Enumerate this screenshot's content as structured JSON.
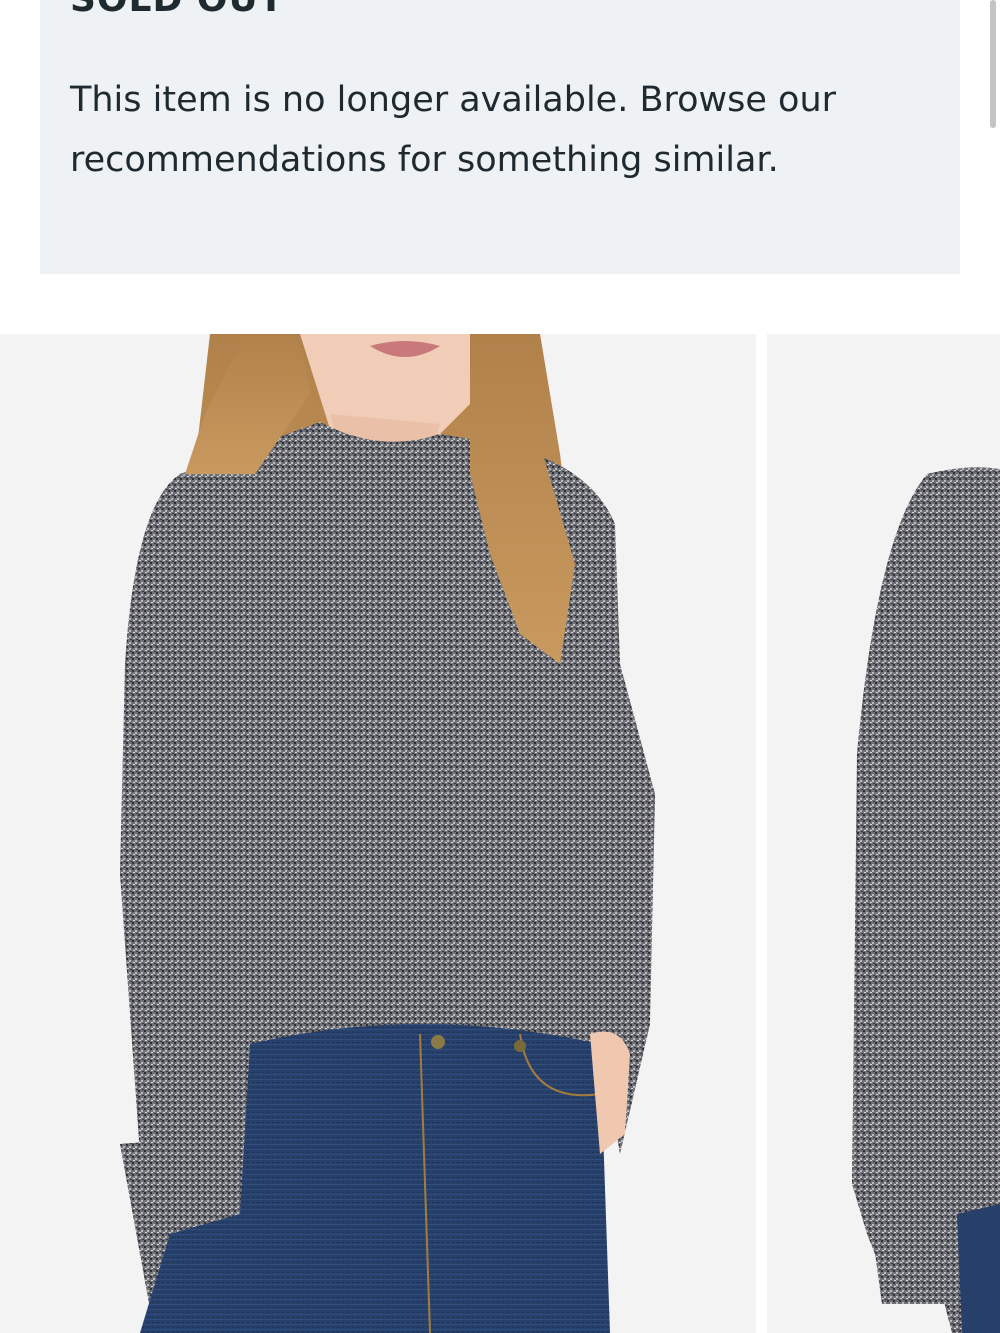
{
  "notice": {
    "title": "SOLD OUT",
    "message": "This item is no longer available. Browse our recommendations for something similar."
  },
  "carousel": {
    "images": [
      {
        "name": "product-image-front"
      },
      {
        "name": "product-image-side"
      }
    ]
  },
  "colors": {
    "notice_background": "#eef2f5",
    "text": "#1f2a30",
    "image_background": "#f3f3f3"
  }
}
